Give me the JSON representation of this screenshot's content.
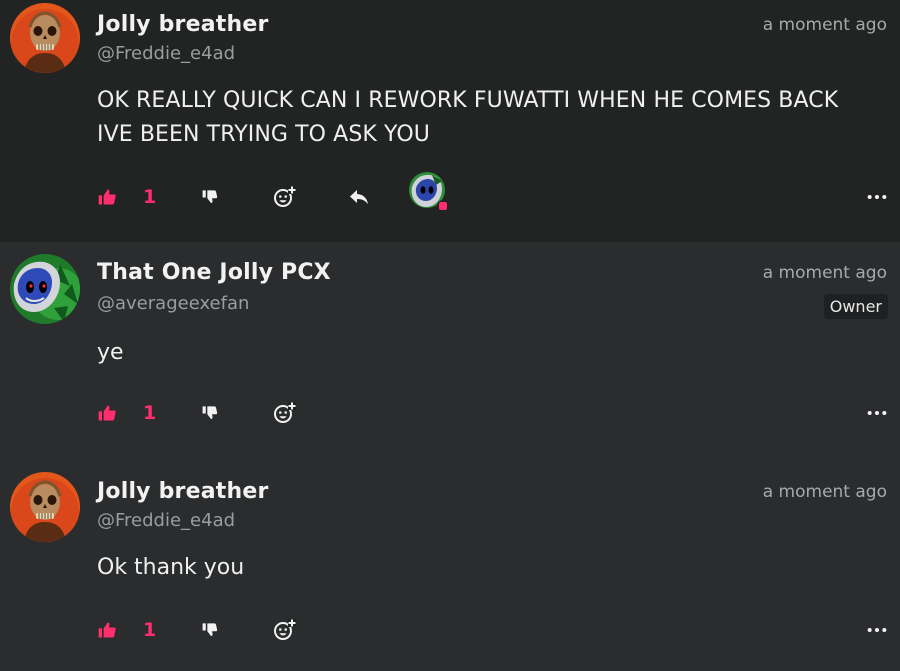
{
  "colors": {
    "accent": "#ff2e6e",
    "text": "#f0f0f0",
    "muted": "#9a9c9d"
  },
  "comments": [
    {
      "author": "Jolly breather",
      "handle": "@Freddie_e4ad",
      "time": "a moment ago",
      "text": "OK REALLY QUICK CAN I REWORK FUWATTI WHEN HE COMES BACK IVE BEEN TRYING TO ASK YOU",
      "likes": "1",
      "avatar_icon": "skull-avatar-icon",
      "reactor_icon": "reactor-avatar-icon"
    },
    {
      "author": "That One Jolly PCX",
      "handle": "@averageexefan",
      "time": "a moment ago",
      "badge": "Owner",
      "text": "ye",
      "likes": "1",
      "avatar_icon": "hedgehog-avatar-icon"
    },
    {
      "author": "Jolly breather",
      "handle": "@Freddie_e4ad",
      "time": "a moment ago",
      "text": "Ok thank you",
      "likes": "1",
      "avatar_icon": "skull-avatar-icon"
    }
  ]
}
